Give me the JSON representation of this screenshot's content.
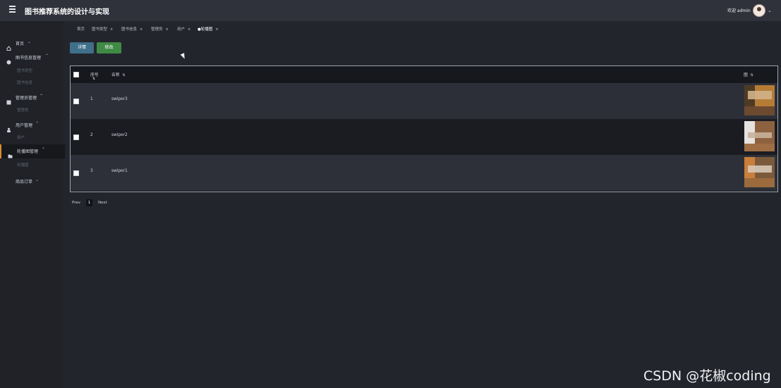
{
  "header": {
    "title": "图书推荐系统的设计与实现",
    "welcome": "欢迎 admin"
  },
  "sidebar": {
    "items": [
      {
        "label": "首页",
        "arrow": "⌄"
      },
      {
        "label": "图书信息管理",
        "arrow": "⌃",
        "subs": [
          "图书类型",
          "图书信息"
        ]
      },
      {
        "label": "管理员管理",
        "arrow": "⌃",
        "subs": [
          "管理员"
        ]
      },
      {
        "label": "用户管理",
        "arrow": "⌃",
        "subs": [
          "用户"
        ]
      },
      {
        "label": "轮播图管理",
        "arrow": "⌃",
        "subs": [
          "轮播图"
        ]
      },
      {
        "label": "商品订单",
        "arrow": "⌄"
      }
    ]
  },
  "tabs": [
    {
      "label": "首页",
      "close": ""
    },
    {
      "label": "图书类型",
      "close": "×"
    },
    {
      "label": "图书信息",
      "close": "×"
    },
    {
      "label": "管理员",
      "close": "×"
    },
    {
      "label": "用户",
      "close": "×"
    },
    {
      "label": "●轮播图",
      "close": "×"
    }
  ],
  "toolbar": {
    "detail_label": "详情",
    "edit_label": "修改"
  },
  "table": {
    "headers": {
      "no": "序号",
      "name": "名称",
      "image": "图"
    },
    "rows": [
      {
        "no": "1",
        "name": "swiper3"
      },
      {
        "no": "2",
        "name": "swiper2"
      },
      {
        "no": "3",
        "name": "swiper1"
      }
    ]
  },
  "pagination": {
    "prev": "Prev",
    "current": "1",
    "next": "Next"
  },
  "watermark": "CSDN @花椒coding"
}
